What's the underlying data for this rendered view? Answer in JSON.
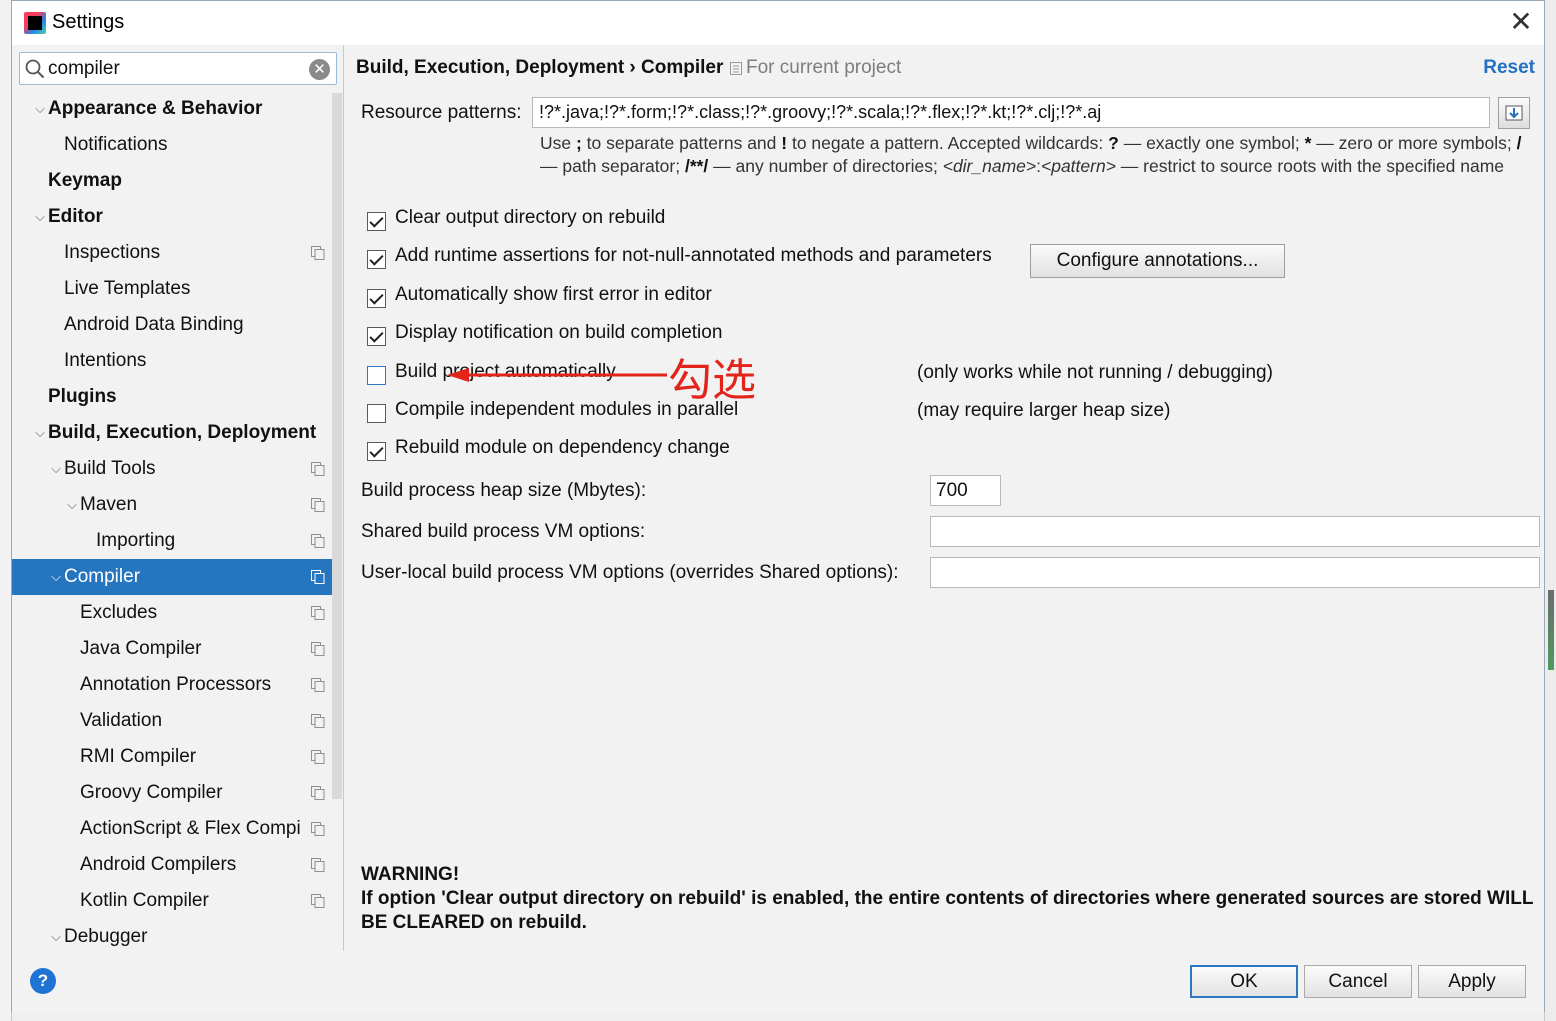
{
  "window": {
    "title": "Settings",
    "close_glyph": "✕"
  },
  "search": {
    "value": "compiler",
    "clear_glyph": "✕"
  },
  "tree": [
    {
      "label": "Appearance & Behavior",
      "bold": true,
      "level": 0,
      "arrow": "expanded",
      "scope_icon": false
    },
    {
      "label": "Notifications",
      "bold": false,
      "level": 1,
      "arrow": "none",
      "scope_icon": false
    },
    {
      "label": "Keymap",
      "bold": true,
      "level": 0,
      "arrow": "none",
      "scope_icon": false
    },
    {
      "label": "Editor",
      "bold": true,
      "level": 0,
      "arrow": "expanded",
      "scope_icon": false
    },
    {
      "label": "Inspections",
      "bold": false,
      "level": 1,
      "arrow": "none",
      "scope_icon": true
    },
    {
      "label": "Live Templates",
      "bold": false,
      "level": 1,
      "arrow": "none",
      "scope_icon": false
    },
    {
      "label": "Android Data Binding",
      "bold": false,
      "level": 1,
      "arrow": "none",
      "scope_icon": false
    },
    {
      "label": "Intentions",
      "bold": false,
      "level": 1,
      "arrow": "none",
      "scope_icon": false
    },
    {
      "label": "Plugins",
      "bold": true,
      "level": 0,
      "arrow": "none",
      "scope_icon": false
    },
    {
      "label": "Build, Execution, Deployment",
      "bold": true,
      "level": 0,
      "arrow": "expanded",
      "scope_icon": false
    },
    {
      "label": "Build Tools",
      "bold": false,
      "level": 1,
      "arrow": "expanded",
      "scope_icon": true
    },
    {
      "label": "Maven",
      "bold": false,
      "level": 2,
      "arrow": "expanded",
      "scope_icon": true
    },
    {
      "label": "Importing",
      "bold": false,
      "level": 3,
      "arrow": "none",
      "scope_icon": true
    },
    {
      "label": "Compiler",
      "bold": false,
      "level": 1,
      "arrow": "expanded",
      "scope_icon": true,
      "selected": true
    },
    {
      "label": "Excludes",
      "bold": false,
      "level": 2,
      "arrow": "none",
      "scope_icon": true
    },
    {
      "label": "Java Compiler",
      "bold": false,
      "level": 2,
      "arrow": "none",
      "scope_icon": true
    },
    {
      "label": "Annotation Processors",
      "bold": false,
      "level": 2,
      "arrow": "none",
      "scope_icon": true
    },
    {
      "label": "Validation",
      "bold": false,
      "level": 2,
      "arrow": "none",
      "scope_icon": true
    },
    {
      "label": "RMI Compiler",
      "bold": false,
      "level": 2,
      "arrow": "none",
      "scope_icon": true
    },
    {
      "label": "Groovy Compiler",
      "bold": false,
      "level": 2,
      "arrow": "none",
      "scope_icon": true
    },
    {
      "label": "ActionScript & Flex Compi",
      "bold": false,
      "level": 2,
      "arrow": "none",
      "scope_icon": true
    },
    {
      "label": "Android Compilers",
      "bold": false,
      "level": 2,
      "arrow": "none",
      "scope_icon": true
    },
    {
      "label": "Kotlin Compiler",
      "bold": false,
      "level": 2,
      "arrow": "none",
      "scope_icon": true
    },
    {
      "label": "Debugger",
      "bold": false,
      "level": 1,
      "arrow": "expanded",
      "scope_icon": false
    }
  ],
  "header": {
    "breadcrumb": "Build, Execution, Deployment › Compiler",
    "scope_label": "For current project",
    "reset": "Reset"
  },
  "resource": {
    "label": "Resource patterns:",
    "value": "!?*.java;!?*.form;!?*.class;!?*.groovy;!?*.scala;!?*.flex;!?*.kt;!?*.clj;!?*.aj",
    "help": {
      "p1": "Use ",
      "b1": ";",
      "p2": " to separate patterns and ",
      "b2": "!",
      "p3": " to negate a pattern. Accepted wildcards: ",
      "b3": "?",
      "p4": " — exactly one symbol; ",
      "b4": "*",
      "p5": " — zero or more symbols; ",
      "b5": "/",
      "p6": " — path separator; ",
      "b6": "/**/",
      "p7": " — any number of directories; ",
      "i1": "<dir_name>",
      "p8": ":",
      "i2": "<pattern>",
      "p9": " — restrict to source roots with the specified name"
    }
  },
  "options": [
    {
      "label": "Clear output directory on rebuild",
      "checked": true,
      "note": ""
    },
    {
      "label": "Add runtime assertions for not-null-annotated methods and parameters",
      "checked": true,
      "note": ""
    },
    {
      "label": "Automatically show first error in editor",
      "checked": true,
      "note": ""
    },
    {
      "label": "Display notification on build completion",
      "checked": true,
      "note": ""
    },
    {
      "label": "Build project automatically",
      "checked": false,
      "note": "(only works while not running / debugging)"
    },
    {
      "label": "Compile independent modules in parallel",
      "checked": false,
      "note": "(may require larger heap size)"
    },
    {
      "label": "Rebuild module on dependency change",
      "checked": true,
      "note": ""
    }
  ],
  "configure_button": "Configure annotations...",
  "annotation": {
    "text": "勾选",
    "color": "#e3241b"
  },
  "heap": {
    "label": "Build process heap size (Mbytes):",
    "value": "700"
  },
  "shared_vm": {
    "label": "Shared build process VM options:",
    "value": ""
  },
  "user_vm": {
    "label": "User-local build process VM options (overrides Shared options):",
    "value": ""
  },
  "warning": {
    "title": "WARNING!",
    "body": "If option 'Clear output directory on rebuild' is enabled, the entire contents of directories where generated sources are stored WILL BE CLEARED on rebuild."
  },
  "footer": {
    "ok": "OK",
    "cancel": "Cancel",
    "apply": "Apply",
    "help_glyph": "?"
  },
  "colors": {
    "selection": "#2675bf",
    "link": "#2470c2",
    "focus": "#2f77c4"
  }
}
